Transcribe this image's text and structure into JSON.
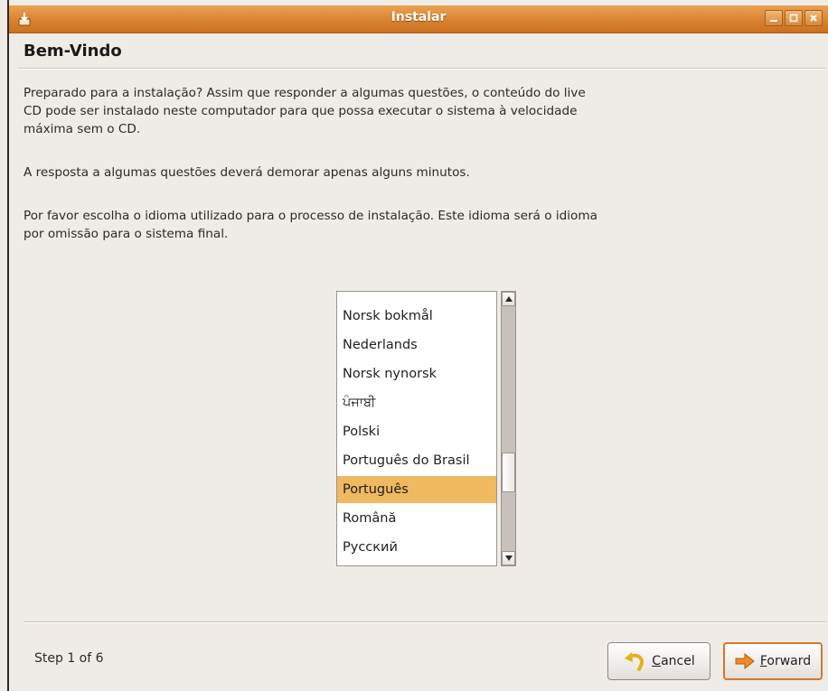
{
  "window": {
    "title": "Instalar",
    "controls": [
      "minimize-icon",
      "maximize-icon",
      "close-icon"
    ]
  },
  "page": {
    "heading": "Bem-Vindo",
    "paragraphs": [
      "Preparado para a instalação? Assim que responder a algumas questões, o conteúdo do live\nCD pode ser instalado neste computador para que possa executar o sistema à velocidade\nmáxima sem o CD.",
      "A resposta a algumas questões deverá demorar apenas alguns minutos.",
      "Por favor escolha o idioma utilizado para o processo de instalação. Este idioma será o idioma\npor omissão para o sistema final."
    ]
  },
  "language_list": {
    "items": [
      "Norsk bokmål",
      "Nederlands",
      "Norsk nynorsk",
      "ਪੰਜਾਬੀ",
      "Polski",
      "Português do Brasil",
      "Português",
      "Română",
      "Русский"
    ],
    "selected": "Português"
  },
  "footer": {
    "step": "Step 1 of 6",
    "cancel_label": "Cancel",
    "forward_label": "Forward"
  },
  "colors": {
    "titlebar": "#d9822f",
    "selection": "#f0b860",
    "background": "#efebe7",
    "forward_border": "#d2782a"
  }
}
